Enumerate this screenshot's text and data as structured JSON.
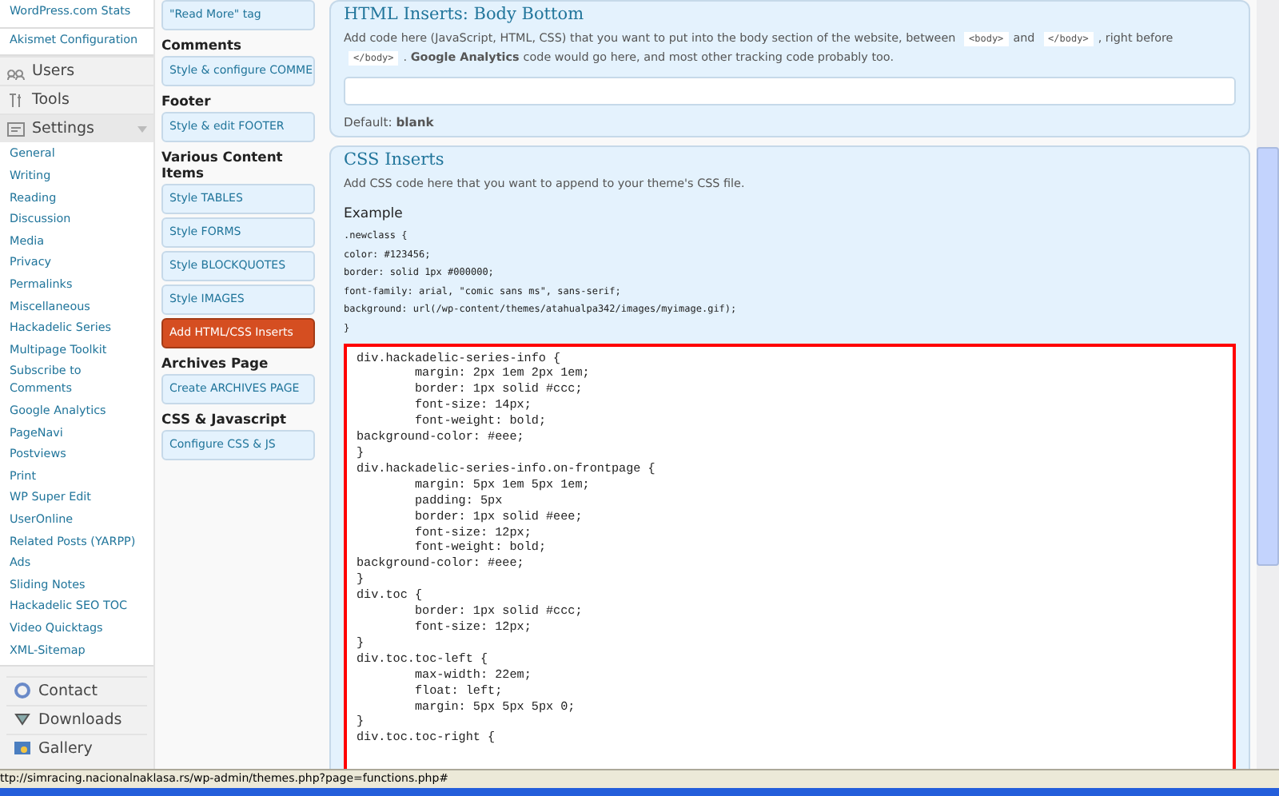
{
  "admin_menu": [
    {
      "kind": "link",
      "label": "WordPress.com Stats"
    },
    {
      "kind": "link",
      "label": "Akismet Configuration"
    },
    {
      "kind": "section",
      "label": "Users",
      "expanded": false
    },
    {
      "kind": "section",
      "label": "Tools",
      "expanded": false
    },
    {
      "kind": "section",
      "label": "Settings",
      "expanded": true,
      "children": [
        "General",
        "Writing",
        "Reading",
        "Discussion",
        "Media",
        "Privacy",
        "Permalinks",
        "Miscellaneous",
        "Hackadelic Series",
        "Multipage Toolkit",
        "Subscribe to Comments",
        "Google Analytics",
        "PageNavi",
        "Postviews",
        "Print",
        "WP Super Edit",
        "UserOnline",
        "Related Posts (YARPP)",
        "Ads",
        "Sliding Notes",
        "Hackadelic SEO TOC",
        "Video Quicktags",
        "XML-Sitemap"
      ]
    }
  ],
  "admin_menu_lower": [
    {
      "kind": "section",
      "label": "Contact",
      "expanded": false
    },
    {
      "kind": "section",
      "label": "Downloads",
      "expanded": false
    },
    {
      "kind": "section",
      "label": "Gallery",
      "expanded": false
    }
  ],
  "theme_nav": [
    {
      "buttons": [
        {
          "label": "\"Read More\" tag",
          "selected": false
        }
      ]
    },
    {
      "heading": "Comments",
      "buttons": [
        {
          "label": "Style & configure COMME",
          "selected": false
        }
      ]
    },
    {
      "heading": "Footer",
      "buttons": [
        {
          "label": "Style & edit FOOTER",
          "selected": false
        }
      ]
    },
    {
      "heading": "Various Content Items",
      "buttons": [
        {
          "label": "Style TABLES",
          "selected": false
        },
        {
          "label": "Style FORMS",
          "selected": false
        },
        {
          "label": "Style BLOCKQUOTES",
          "selected": false
        },
        {
          "label": "Style IMAGES",
          "selected": false
        },
        {
          "label": "Add HTML/CSS Inserts",
          "selected": true
        }
      ]
    },
    {
      "heading": "Archives Page",
      "buttons": [
        {
          "label": "Create ARCHIVES PAGE",
          "selected": false
        }
      ]
    },
    {
      "heading": "CSS & Javascript",
      "buttons": [
        {
          "label": "Configure CSS & JS",
          "selected": false
        }
      ]
    }
  ],
  "panels": [
    {
      "title": "HTML Inserts: Body Bottom",
      "description": [
        {
          "kind": "text",
          "text": "Add code here (JavaScript, HTML, CSS) that you want to put into the body section of the website, between"
        },
        {
          "kind": "code",
          "text": "<body>"
        },
        {
          "kind": "text",
          "text": "and"
        },
        {
          "kind": "code",
          "text": "</body>"
        },
        {
          "kind": "text",
          "text": ", right before"
        },
        {
          "kind": "code",
          "text": "</body>"
        },
        {
          "kind": "text",
          "text": "."
        },
        {
          "kind": "bold",
          "text": "Google Analytics"
        },
        {
          "kind": "text",
          "text": "code would go here, and most other tracking code probably too."
        }
      ],
      "field": {
        "highlighted": false
      },
      "default_label": "Default:",
      "default_value": "blank"
    },
    {
      "title": "CSS Inserts",
      "description": [
        {
          "kind": "text",
          "text": "Add CSS code here that you want to append to your theme's CSS file."
        }
      ],
      "example_heading": "Example",
      "example_lines": [
        ".newclass {",
        "color: #123456;",
        "border: solid 1px #000000;",
        "font-family: arial, \"comic sans ms\", sans-serif;",
        "background: url(/wp-content/themes/atahualpa342/images/myimage.gif);",
        "}"
      ],
      "field": {
        "value": "div.hackadelic-series-info {\n\tmargin: 2px 1em 2px 1em;\n\tborder: 1px solid #ccc;\n\tfont-size: 14px;\n\tfont-weight: bold;\nbackground-color: #eee;\n}\ndiv.hackadelic-series-info.on-frontpage {\n\tmargin: 5px 1em 5px 1em;\n\tpadding: 5px\n\tborder: 1px solid #eee;\n\tfont-size: 12px;\n\tfont-weight: bold;\nbackground-color: #eee;\n}\ndiv.toc {\n\tborder: 1px solid #ccc;\n\tfont-size: 12px;\n}\ndiv.toc.toc-left {\n\tmax-width: 22em;\n\tfloat: left;\n\tmargin: 5px 5px 5px 0;\n}\ndiv.toc.toc-right {",
        "highlighted": true
      }
    }
  ],
  "status_bar": {
    "url": "ttp://simracing.nacionalnaklasa.rs/wp-admin/themes.php?page=functions.php#"
  }
}
